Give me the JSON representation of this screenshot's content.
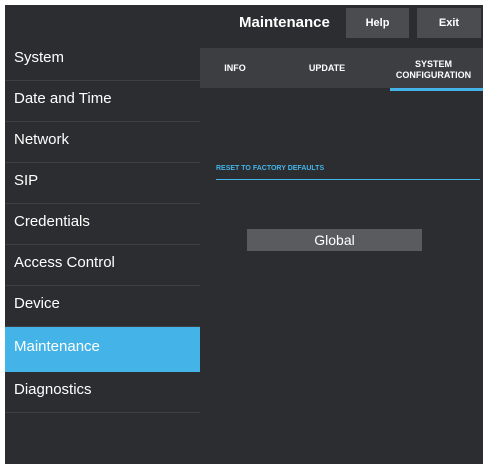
{
  "header": {
    "title": "Maintenance",
    "help_label": "Help",
    "exit_label": "Exit"
  },
  "sidebar": {
    "items": [
      {
        "label": "System",
        "active": false
      },
      {
        "label": "Date and Time",
        "active": false
      },
      {
        "label": "Network",
        "active": false
      },
      {
        "label": "SIP",
        "active": false
      },
      {
        "label": "Credentials",
        "active": false
      },
      {
        "label": "Access Control",
        "active": false
      },
      {
        "label": "Device",
        "active": false
      },
      {
        "label": "Maintenance",
        "active": true
      },
      {
        "label": "Diagnostics",
        "active": false
      }
    ]
  },
  "tabs": [
    {
      "label": "INFO"
    },
    {
      "label": "UPDATE"
    },
    {
      "label": "SYSTEM\nCONFIGURATION",
      "active": true
    }
  ],
  "section": {
    "heading": "RESET TO FACTORY DEFAULTS",
    "button_label": "Global"
  },
  "colors": {
    "accent": "#44b4e8",
    "background": "#2b2d30",
    "button": "#4a4c50"
  }
}
